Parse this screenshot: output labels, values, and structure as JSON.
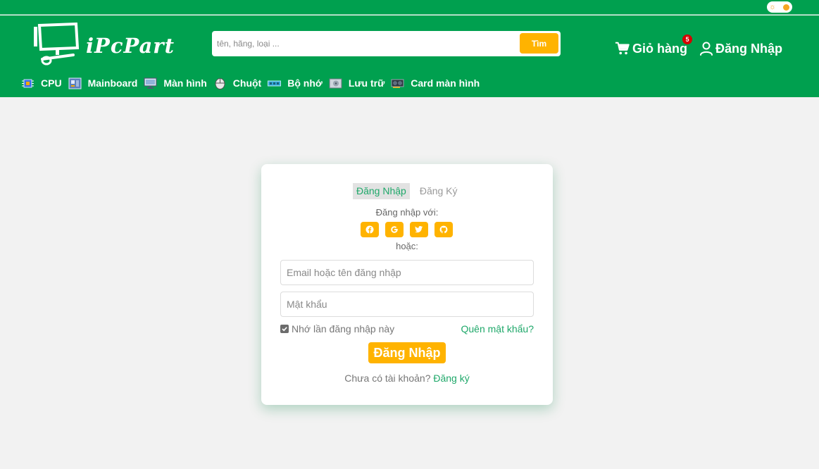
{
  "header": {
    "brand": "iPcPart",
    "search": {
      "placeholder": "tên, hãng, loại ...",
      "value": "",
      "button_label": "Tìm"
    },
    "cart": {
      "label": "Giỏ hàng",
      "count": "5"
    },
    "login_label": "Đăng Nhập",
    "categories": [
      {
        "label": "CPU",
        "icon": "cpu-icon"
      },
      {
        "label": "Mainboard",
        "icon": "mainboard-icon"
      },
      {
        "label": "Màn hình",
        "icon": "monitor-icon"
      },
      {
        "label": "Chuột",
        "icon": "mouse-icon"
      },
      {
        "label": "Bộ nhớ",
        "icon": "ram-icon"
      },
      {
        "label": "Lưu trữ",
        "icon": "storage-icon"
      },
      {
        "label": "Card màn hình",
        "icon": "gpu-icon"
      }
    ]
  },
  "login": {
    "tabs": [
      {
        "label": "Đăng Nhập",
        "active": true
      },
      {
        "label": "Đăng Ký",
        "active": false
      }
    ],
    "social_label": "Đăng nhập với:",
    "socials": [
      "facebook-icon",
      "google-icon",
      "twitter-icon",
      "github-icon"
    ],
    "or_label": "hoặc:",
    "email_placeholder": "Email hoặc tên đăng nhập",
    "password_placeholder": "Mật khẩu",
    "remember_label": "Nhớ lần đăng nhập này",
    "remember_checked": true,
    "forgot_label": "Quên mật khẩu?",
    "submit_label": "Đăng Nhập",
    "signup_prompt": "Chưa có tài khoản?",
    "signup_link": "Đăng ký"
  },
  "colors": {
    "brand_green": "#00a04f",
    "accent_yellow": "#ffb300",
    "link_green": "#1fa86a",
    "badge_red": "#d60000",
    "page_bg": "#f2f2f2"
  }
}
